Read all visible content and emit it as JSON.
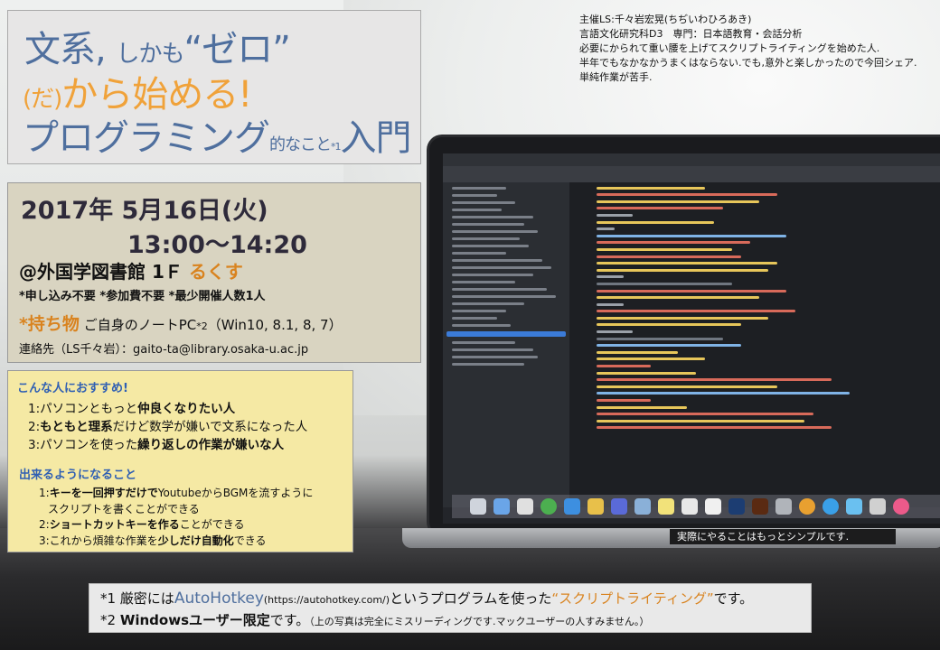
{
  "title": {
    "line1_a": "文系",
    "line1_b": ", ",
    "line1_c": "しかも",
    "line1_d": "“ゼロ”",
    "line2_a": "(だ)",
    "line2_b": "から始める!",
    "line3_a": "プログラミング",
    "line3_b": "的なこと",
    "line3_c": "*1",
    "line3_d": "入門"
  },
  "event": {
    "date": "2017年 5月16日(火)",
    "time": "13:00～14:20",
    "venue_a": "@外国学図書館 1Ｆ",
    "venue_b": "るくす",
    "notes": "*申し込み不要 *参加費不要 *最少開催人数1人",
    "bring_label": "*持ち物",
    "bring_a": "ご自身のノートPC",
    "bring_b": "*2",
    "bring_c": "（Win10, 8.1, 8, 7）",
    "contact": "連絡先（LS千々岩）：gaito-ta@library.osaka-u.ac.jp"
  },
  "recommend": {
    "heading": "こんな人におすすめ!",
    "items": [
      {
        "a": "1:パソコンともっと",
        "b": "仲良くなりたい人",
        "c": ""
      },
      {
        "a": "2:",
        "b": "もともと理系",
        "c": "だけど数学が嫌いで文系になった人"
      },
      {
        "a": "3:パソコンを使った",
        "b": "繰り返しの作業が嫌いな人",
        "c": ""
      }
    ]
  },
  "outcomes": {
    "heading": "出来るようになること",
    "items": [
      {
        "a": "1:",
        "b": "キーを一回押すだけで",
        "c": "YoutubeからBGMを流すように"
      },
      {
        "a": "スクリプトを書くことができる",
        "b": "",
        "c": ""
      },
      {
        "a": "2:",
        "b": "ショートカットキーを作る",
        "c": "ことができる"
      },
      {
        "a": "3:これから煩雑な作業を",
        "b": "少しだけ自動化",
        "c": "できる"
      }
    ]
  },
  "organizer": {
    "lines": [
      "主催LS:千々岩宏晃(ちぢいわひろあき)",
      "言語文化研究科D3　専門：日本語教育・会話分析",
      "必要にかられて重い腰を上げてスクリプトライティングを始めた人.",
      "半年でもなかなかうまくはならない.でも,意外と楽しかったので今回シェア.",
      "単純作業が苦手."
    ]
  },
  "photo_caption": "実際にやることはもっとシンプルです.",
  "footnotes": {
    "f1_a": "*1 厳密には",
    "f1_b": "AutoHotkey",
    "f1_c": "(https://autohotkey.com/)",
    "f1_d": "というプログラムを使った",
    "f1_e": "“スクリプトライティング”",
    "f1_f": "です。",
    "f2_a": "*2 ",
    "f2_b": "Windowsユーザー限定",
    "f2_c": "です。",
    "f2_d": "（上の写真は完全にミスリーディングです.マックユーザーの人すみません。）"
  },
  "colors": {
    "title_blue": "#4f6f9e",
    "accent_orange": "#f0a23a",
    "heading_blue": "#2f5fb3",
    "date_box_bg": "#d9d4c1",
    "recommend_box_bg": "#f5e9a4"
  }
}
